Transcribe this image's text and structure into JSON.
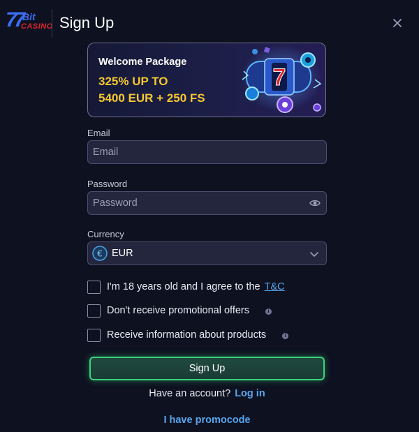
{
  "brand": {
    "logo_number": "7",
    "logo_bit": "Bit",
    "logo_casino": "CASINO",
    "colors": {
      "blue": "#3a6df0",
      "red": "#e0242e"
    }
  },
  "header": {
    "title": "Sign Up",
    "close_icon": "close-icon"
  },
  "promo": {
    "title": "Welcome Package",
    "line1": "325% UP TO",
    "line2": "5400 EUR + 250 FS",
    "art_icon": "slot-machine-icon",
    "accent": "#f5c832"
  },
  "form": {
    "email": {
      "label": "Email",
      "placeholder": "Email",
      "value": ""
    },
    "password": {
      "label": "Password",
      "placeholder": "Password",
      "value": "",
      "toggle_icon": "eye-icon"
    },
    "currency": {
      "label": "Currency",
      "value": "EUR",
      "icon": "euro-icon",
      "dropdown_icon": "chevron-down-icon"
    }
  },
  "checkboxes": {
    "age": {
      "text": "I'm 18 years old and I agree to the",
      "link": "T&C",
      "checked": false
    },
    "no_promo": {
      "text": "Don't receive promotional offers",
      "checked": false,
      "info_icon": "info-icon"
    },
    "product_info": {
      "text": "Receive information about products",
      "checked": false,
      "info_icon": "info-icon"
    }
  },
  "actions": {
    "signup_label": "Sign Up",
    "have_account": "Have an account?",
    "login_label": "Log in",
    "promocode_label": "I have promocode",
    "accent": "#3ad47c",
    "link_color": "#58a7f0"
  }
}
